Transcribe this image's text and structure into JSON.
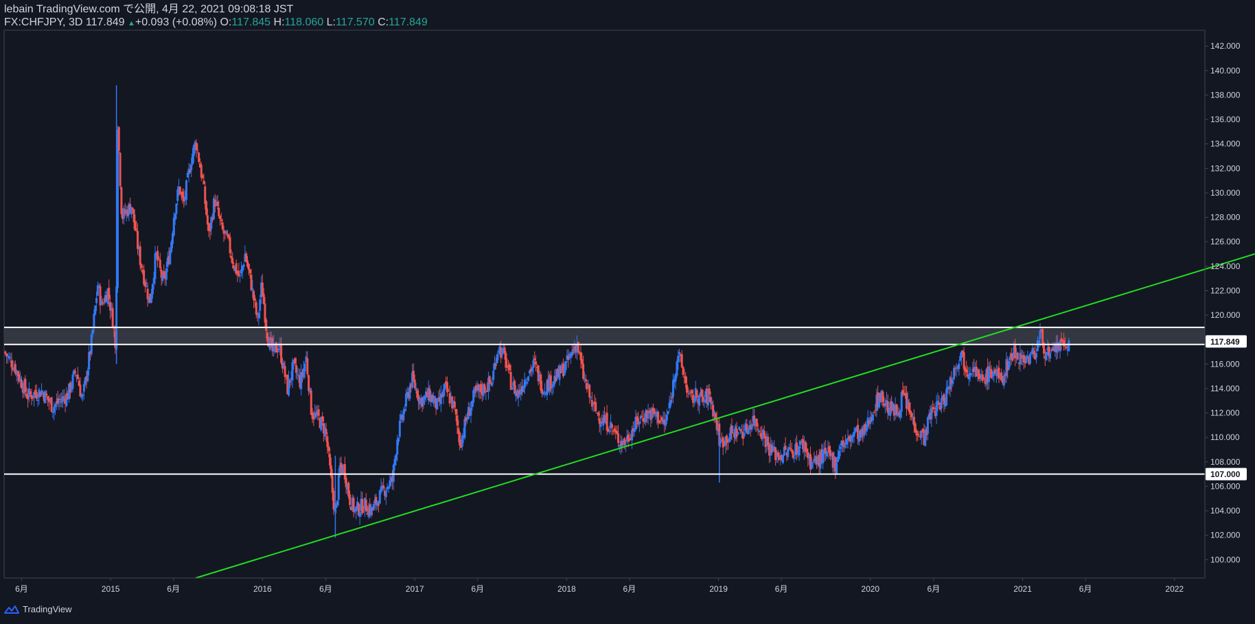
{
  "header": {
    "published_line": "lebain TradingView.com で公開, 4月 22, 2021 09:08:18 JST",
    "symbol_tf": "FX:CHFJPY, 3D",
    "last": "117.849",
    "change": "+0.093 (+0.08%)",
    "o_label": "O:",
    "o_value": "117.845",
    "h_label": "H:",
    "h_value": "118.060",
    "l_label": "L:",
    "l_value": "117.570",
    "c_label": "C:",
    "c_value": "117.849"
  },
  "brand": {
    "name": "TradingView",
    "icon": "tradingview-logo-icon"
  },
  "colors": {
    "background": "#131722",
    "up_candle": "#3179f5",
    "down_candle": "#ef5350",
    "trendline": "#22dd22",
    "levels": "#ffffff",
    "zone_fill": "#3a3d48",
    "axis_text": "#d1d4dc"
  },
  "chart_data": {
    "type": "candlestick",
    "symbol": "FX:CHFJPY",
    "timeframe": "3D",
    "y_axis": {
      "min": 98.5,
      "max": 143.3,
      "ticks": [
        "100.000",
        "102.000",
        "104.000",
        "106.000",
        "108.000",
        "110.000",
        "112.000",
        "114.000",
        "116.000",
        "118.000",
        "120.000",
        "122.000",
        "124.000",
        "126.000",
        "128.000",
        "130.000",
        "132.000",
        "134.000",
        "136.000",
        "138.000",
        "140.000",
        "142.000"
      ],
      "price_badges": [
        "117.849",
        "107.000"
      ]
    },
    "x_axis": {
      "start": "2014-04-20",
      "end": "2022-03-15",
      "ticks": [
        {
          "label": "6月",
          "date": "2014-06-01"
        },
        {
          "label": "2015",
          "date": "2015-01-01"
        },
        {
          "label": "6月",
          "date": "2015-06-01"
        },
        {
          "label": "2016",
          "date": "2016-01-01"
        },
        {
          "label": "6月",
          "date": "2016-06-01"
        },
        {
          "label": "2017",
          "date": "2017-01-01"
        },
        {
          "label": "6月",
          "date": "2017-06-01"
        },
        {
          "label": "2018",
          "date": "2018-01-01"
        },
        {
          "label": "6月",
          "date": "2018-06-01"
        },
        {
          "label": "2019",
          "date": "2019-01-01"
        },
        {
          "label": "6月",
          "date": "2019-06-01"
        },
        {
          "label": "2020",
          "date": "2020-01-01"
        },
        {
          "label": "6月",
          "date": "2020-06-01"
        },
        {
          "label": "2021",
          "date": "2021-01-01"
        },
        {
          "label": "6月",
          "date": "2021-06-01"
        },
        {
          "label": "2022",
          "date": "2022-01-01"
        }
      ]
    },
    "price_path": [
      [
        "2014-04-20",
        117.0
      ],
      [
        "2014-05-15",
        115.8
      ],
      [
        "2014-06-15",
        113.4
      ],
      [
        "2014-07-20",
        113.8
      ],
      [
        "2014-08-15",
        112.5
      ],
      [
        "2014-09-20",
        113.5
      ],
      [
        "2014-10-10",
        115.5
      ],
      [
        "2014-10-25",
        113.0
      ],
      [
        "2014-11-15",
        117.5
      ],
      [
        "2014-12-01",
        122.5
      ],
      [
        "2014-12-10",
        120.8
      ],
      [
        "2014-12-25",
        122.0
      ],
      [
        "2015-01-08",
        119.2
      ],
      [
        "2015-01-14",
        116.2
      ],
      [
        "2015-01-17",
        136.5
      ],
      [
        "2015-01-28",
        128.0
      ],
      [
        "2015-02-20",
        129.0
      ],
      [
        "2015-03-10",
        125.0
      ],
      [
        "2015-04-05",
        121.0
      ],
      [
        "2015-04-20",
        125.0
      ],
      [
        "2015-05-08",
        122.5
      ],
      [
        "2015-05-25",
        125.5
      ],
      [
        "2015-06-03",
        128.5
      ],
      [
        "2015-06-15",
        130.5
      ],
      [
        "2015-06-25",
        129.0
      ],
      [
        "2015-07-15",
        133.0
      ],
      [
        "2015-07-25",
        134.2
      ],
      [
        "2015-08-10",
        131.0
      ],
      [
        "2015-08-25",
        126.5
      ],
      [
        "2015-09-08",
        129.5
      ],
      [
        "2015-09-25",
        127.0
      ],
      [
        "2015-10-10",
        126.0
      ],
      [
        "2015-10-25",
        124.0
      ],
      [
        "2015-11-08",
        123.0
      ],
      [
        "2015-11-20",
        125.0
      ],
      [
        "2015-12-05",
        122.5
      ],
      [
        "2015-12-20",
        119.5
      ],
      [
        "2015-12-30",
        122.5
      ],
      [
        "2016-01-12",
        118.5
      ],
      [
        "2016-01-25",
        117.0
      ],
      [
        "2016-02-10",
        117.5
      ],
      [
        "2016-03-01",
        114.0
      ],
      [
        "2016-03-15",
        115.8
      ],
      [
        "2016-04-01",
        114.5
      ],
      [
        "2016-04-15",
        116.5
      ],
      [
        "2016-04-28",
        112.0
      ],
      [
        "2016-05-15",
        111.5
      ],
      [
        "2016-06-01",
        110.5
      ],
      [
        "2016-06-12",
        107.0
      ],
      [
        "2016-06-24",
        103.5
      ],
      [
        "2016-07-05",
        107.5
      ],
      [
        "2016-07-15",
        107.5
      ],
      [
        "2016-07-28",
        105.0
      ],
      [
        "2016-08-10",
        104.0
      ],
      [
        "2016-09-01",
        104.5
      ],
      [
        "2016-09-20",
        104.0
      ],
      [
        "2016-10-05",
        105.0
      ],
      [
        "2016-10-25",
        106.0
      ],
      [
        "2016-11-08",
        106.5
      ],
      [
        "2016-11-20",
        110.0
      ],
      [
        "2016-12-15",
        113.5
      ],
      [
        "2016-12-25",
        114.8
      ],
      [
        "2017-01-15",
        113.0
      ],
      [
        "2017-02-05",
        113.5
      ],
      [
        "2017-02-25",
        112.5
      ],
      [
        "2017-03-15",
        114.0
      ],
      [
        "2017-04-05",
        112.5
      ],
      [
        "2017-04-20",
        109.5
      ],
      [
        "2017-05-05",
        111.5
      ],
      [
        "2017-05-25",
        113.5
      ],
      [
        "2017-06-15",
        114.0
      ],
      [
        "2017-07-05",
        114.5
      ],
      [
        "2017-07-20",
        117.5
      ],
      [
        "2017-08-05",
        116.5
      ],
      [
        "2017-08-20",
        114.5
      ],
      [
        "2017-09-05",
        113.5
      ],
      [
        "2017-09-25",
        115.0
      ],
      [
        "2017-10-15",
        116.0
      ],
      [
        "2017-11-05",
        114.0
      ],
      [
        "2017-11-20",
        114.5
      ],
      [
        "2017-12-10",
        115.0
      ],
      [
        "2018-01-01",
        116.0
      ],
      [
        "2018-01-25",
        117.8
      ],
      [
        "2018-02-10",
        115.0
      ],
      [
        "2018-03-05",
        112.5
      ],
      [
        "2018-03-25",
        111.5
      ],
      [
        "2018-04-15",
        111.0
      ],
      [
        "2018-05-01",
        110.0
      ],
      [
        "2018-05-20",
        109.5
      ],
      [
        "2018-06-05",
        110.5
      ],
      [
        "2018-06-25",
        111.5
      ],
      [
        "2018-07-15",
        112.0
      ],
      [
        "2018-08-05",
        111.8
      ],
      [
        "2018-08-25",
        111.0
      ],
      [
        "2018-09-08",
        113.0
      ],
      [
        "2018-09-25",
        117.0
      ],
      [
        "2018-10-10",
        115.0
      ],
      [
        "2018-10-25",
        113.0
      ],
      [
        "2018-11-10",
        113.5
      ],
      [
        "2018-11-25",
        113.0
      ],
      [
        "2018-12-10",
        113.5
      ],
      [
        "2018-12-25",
        111.5
      ],
      [
        "2019-01-05",
        109.5
      ],
      [
        "2019-01-20",
        110.0
      ],
      [
        "2019-02-10",
        110.5
      ],
      [
        "2019-03-05",
        110.5
      ],
      [
        "2019-03-25",
        111.5
      ],
      [
        "2019-04-15",
        110.5
      ],
      [
        "2019-05-05",
        109.0
      ],
      [
        "2019-05-25",
        108.5
      ],
      [
        "2019-06-15",
        108.8
      ],
      [
        "2019-07-05",
        109.0
      ],
      [
        "2019-07-25",
        109.5
      ],
      [
        "2019-08-10",
        108.0
      ],
      [
        "2019-08-25",
        108.0
      ],
      [
        "2019-09-10",
        108.5
      ],
      [
        "2019-09-25",
        108.5
      ],
      [
        "2019-10-10",
        107.8
      ],
      [
        "2019-10-20",
        109.5
      ],
      [
        "2019-11-05",
        109.5
      ],
      [
        "2019-11-25",
        110.5
      ],
      [
        "2019-12-10",
        110.0
      ],
      [
        "2019-12-25",
        111.0
      ],
      [
        "2020-01-10",
        112.5
      ],
      [
        "2020-01-25",
        113.5
      ],
      [
        "2020-02-10",
        112.5
      ],
      [
        "2020-03-05",
        112.0
      ],
      [
        "2020-03-20",
        113.5
      ],
      [
        "2020-04-10",
        111.5
      ],
      [
        "2020-04-25",
        110.5
      ],
      [
        "2020-05-10",
        110.0
      ],
      [
        "2020-05-25",
        112.0
      ],
      [
        "2020-06-10",
        112.5
      ],
      [
        "2020-06-25",
        113.0
      ],
      [
        "2020-07-10",
        114.5
      ],
      [
        "2020-07-25",
        116.0
      ],
      [
        "2020-08-05",
        117.0
      ],
      [
        "2020-08-20",
        115.5
      ],
      [
        "2020-09-05",
        116.0
      ],
      [
        "2020-09-20",
        114.5
      ],
      [
        "2020-10-05",
        115.0
      ],
      [
        "2020-10-25",
        115.5
      ],
      [
        "2020-11-10",
        114.5
      ],
      [
        "2020-11-25",
        116.0
      ],
      [
        "2020-12-10",
        117.0
      ],
      [
        "2020-12-30",
        116.5
      ],
      [
        "2021-01-15",
        116.5
      ],
      [
        "2021-02-01",
        117.0
      ],
      [
        "2021-02-12",
        118.5
      ],
      [
        "2021-02-25",
        117.0
      ],
      [
        "2021-03-10",
        116.5
      ],
      [
        "2021-03-25",
        117.5
      ],
      [
        "2021-04-10",
        117.3
      ],
      [
        "2021-04-22",
        117.849
      ]
    ],
    "spikes": [
      {
        "date": "2015-01-15",
        "high": 138.8,
        "low": 116.0
      },
      {
        "date": "2019-01-03",
        "high": 110.5,
        "low": 106.3
      },
      {
        "date": "2016-06-24",
        "high": 108.5,
        "low": 101.8
      }
    ],
    "horizontal_levels": [
      119.0,
      117.6,
      107.0
    ],
    "resistance_zone": [
      117.6,
      119.0
    ],
    "trendline": {
      "p1": {
        "date": "2016-06-15",
        "price": 101.9
      },
      "p2": {
        "date": "2020-08-01",
        "price": 117.6
      }
    }
  }
}
